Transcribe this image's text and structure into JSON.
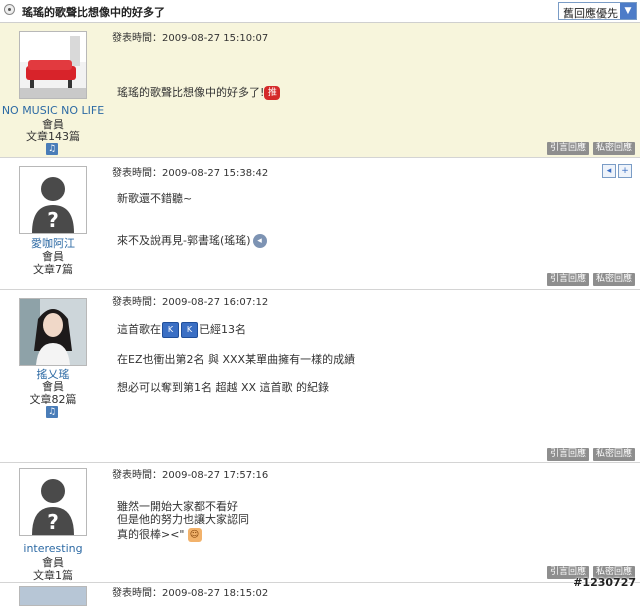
{
  "thread": {
    "title": "瑤瑤的歌聲比想像中的好多了",
    "sort_selected": "舊回應優先"
  },
  "buttons": {
    "quote": "引言回應",
    "private": "私密回應"
  },
  "posts": [
    {
      "user": "NO MUSIC NO LIFE",
      "role": "會員",
      "count": "文章143篇",
      "time": "發表時間：2009-08-27 15:10:07",
      "lines": [
        "瑤瑤的歌聲比想像中的好多了!",
        "推"
      ]
    },
    {
      "user": "愛咖阿江",
      "role": "會員",
      "count": "文章7篇",
      "time": "發表時間：2009-08-27 15:38:42",
      "lines": [
        "新歌還不錯聽~",
        "來不及說再見-郭書瑤(瑤瑤)"
      ]
    },
    {
      "user": "搖乂瑤",
      "role": "會員",
      "count": "文章82篇",
      "time": "發表時間：2009-08-27 16:07:12",
      "lines": [
        "這首歌在",
        "已經13名",
        "在EZ也衝出第2名 與 XXX某單曲擁有一樣的成績",
        "想必可以奪到第1名 超越 XX 這首歌 的紀錄"
      ]
    },
    {
      "user": "interesting",
      "role": "會員",
      "count": "文章1篇",
      "time": "發表時間：2009-08-27 17:57:16",
      "lines": [
        "雖然一開始大家都不看好",
        "但是他的努力也讓大家認同",
        "真的很棒><\""
      ]
    },
    {
      "time": "發表時間：2009-08-27 18:15:02"
    }
  ],
  "watermark": "#1230727",
  "colors": {
    "highlight_row": "#f7f5dc",
    "username": "#2d6aa4",
    "button": "#8e8e8e",
    "accent": "#3b6fc4"
  }
}
